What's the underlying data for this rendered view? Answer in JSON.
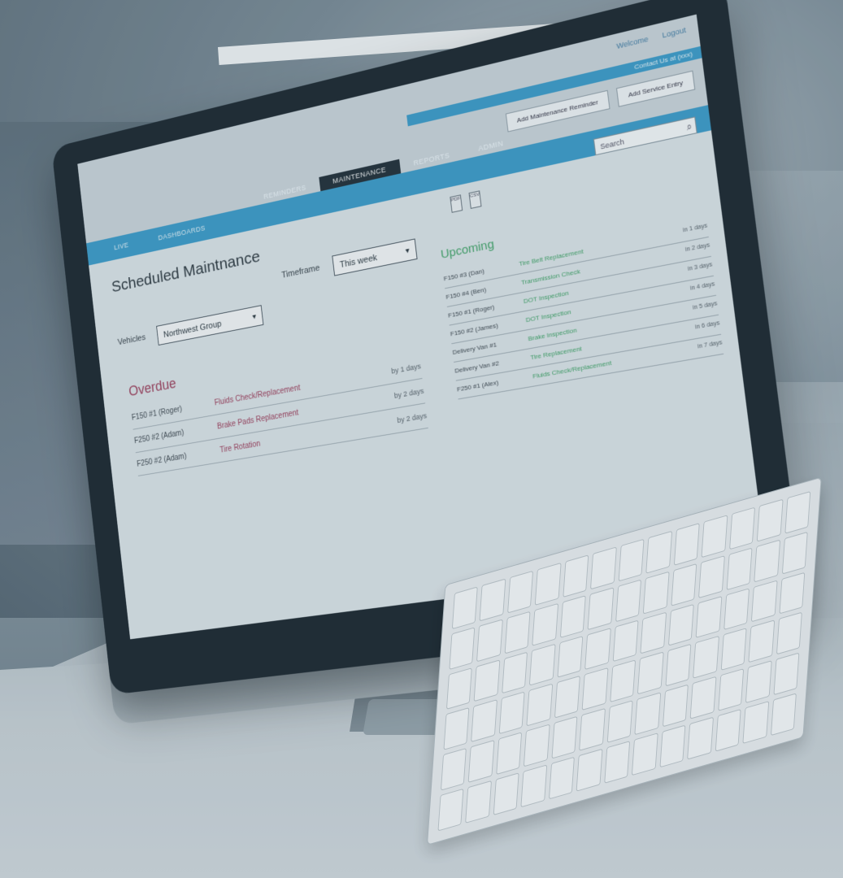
{
  "app": {
    "top_links": [
      "Welcome",
      "Logout"
    ],
    "notice": "Contact Us at (xxx)",
    "buttons": [
      "Add Maintenance Reminder",
      "Add Service Entry"
    ],
    "tabs": [
      {
        "label": "REMINDERS",
        "active": false
      },
      {
        "label": "MAINTENANCE",
        "active": true
      },
      {
        "label": "REPORTS",
        "active": false
      },
      {
        "label": "ADMIN",
        "active": false
      }
    ],
    "nav": [
      "LIVE",
      "DASHBOARDS"
    ],
    "search_placeholder": "Search",
    "page_title": "Scheduled Maintnance",
    "vehicles_label": "Vehicles",
    "vehicles_value": "Northwest Group",
    "timeframe_label": "Timeframe",
    "timeframe_value": "This week",
    "pdf_icons": [
      "PDF",
      "CSV"
    ]
  },
  "overdue": {
    "title": "Overdue",
    "rows": [
      {
        "vehicle": "F150 #1 (Roger)",
        "task": "Fluids Check/Replacement",
        "due": "by 1 days"
      },
      {
        "vehicle": "F250 #2 (Adam)",
        "task": "Brake Pads Replacement",
        "due": "by 2 days"
      },
      {
        "vehicle": "F250 #2 (Adam)",
        "task": "Tire Rotation",
        "due": "by 2 days"
      }
    ]
  },
  "upcoming": {
    "title": "Upcoming",
    "rows": [
      {
        "vehicle": "F150 #3 (Dan)",
        "task": "Tire Belt Replacement",
        "due": "in 1 days"
      },
      {
        "vehicle": "F150 #4 (Ben)",
        "task": "Transmission Check",
        "due": "in 2 days"
      },
      {
        "vehicle": "F150 #1 (Roger)",
        "task": "DOT Inspection",
        "due": "in 3 days"
      },
      {
        "vehicle": "F150 #2 (James)",
        "task": "DOT Inspection",
        "due": "in 4 days"
      },
      {
        "vehicle": "Delivery Van #1",
        "task": "Brake Inspection",
        "due": "in 5 days"
      },
      {
        "vehicle": "Delivery Van #2",
        "task": "Tire Replacement",
        "due": "in 6 days"
      },
      {
        "vehicle": "F250 #1 (Alex)",
        "task": "Fluids Check/Replacement",
        "due": "in 7 days"
      }
    ]
  }
}
